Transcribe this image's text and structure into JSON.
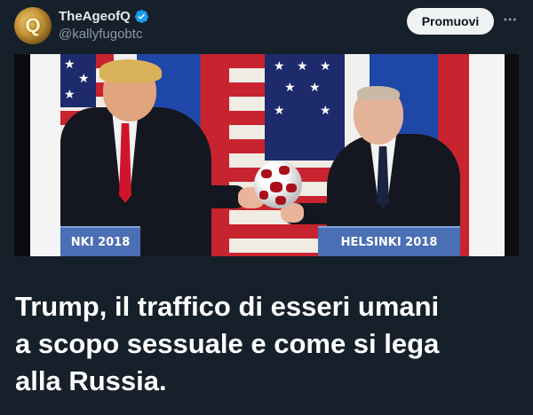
{
  "author": {
    "display_name": "TheAgeofQ",
    "handle": "@kallyfugobtc",
    "avatar_icon": "q-avatar-icon",
    "verified_icon": "verified-badge-icon"
  },
  "actions": {
    "promote_label": "Promuovi",
    "more_icon": "more-dots-icon"
  },
  "media": {
    "podium_left_text": "NKI 2018",
    "podium_right_text": "HELSINKI 2018"
  },
  "headline": {
    "line1": "Trump, il traffico di esseri umani",
    "line2": "a scopo sessuale e come si lega",
    "line3": "alla Russia."
  },
  "colors": {
    "background": "#15202b",
    "verified_blue": "#1d9bf0",
    "button_bg": "#eff3f4",
    "secondary_text": "#8b98a5"
  }
}
